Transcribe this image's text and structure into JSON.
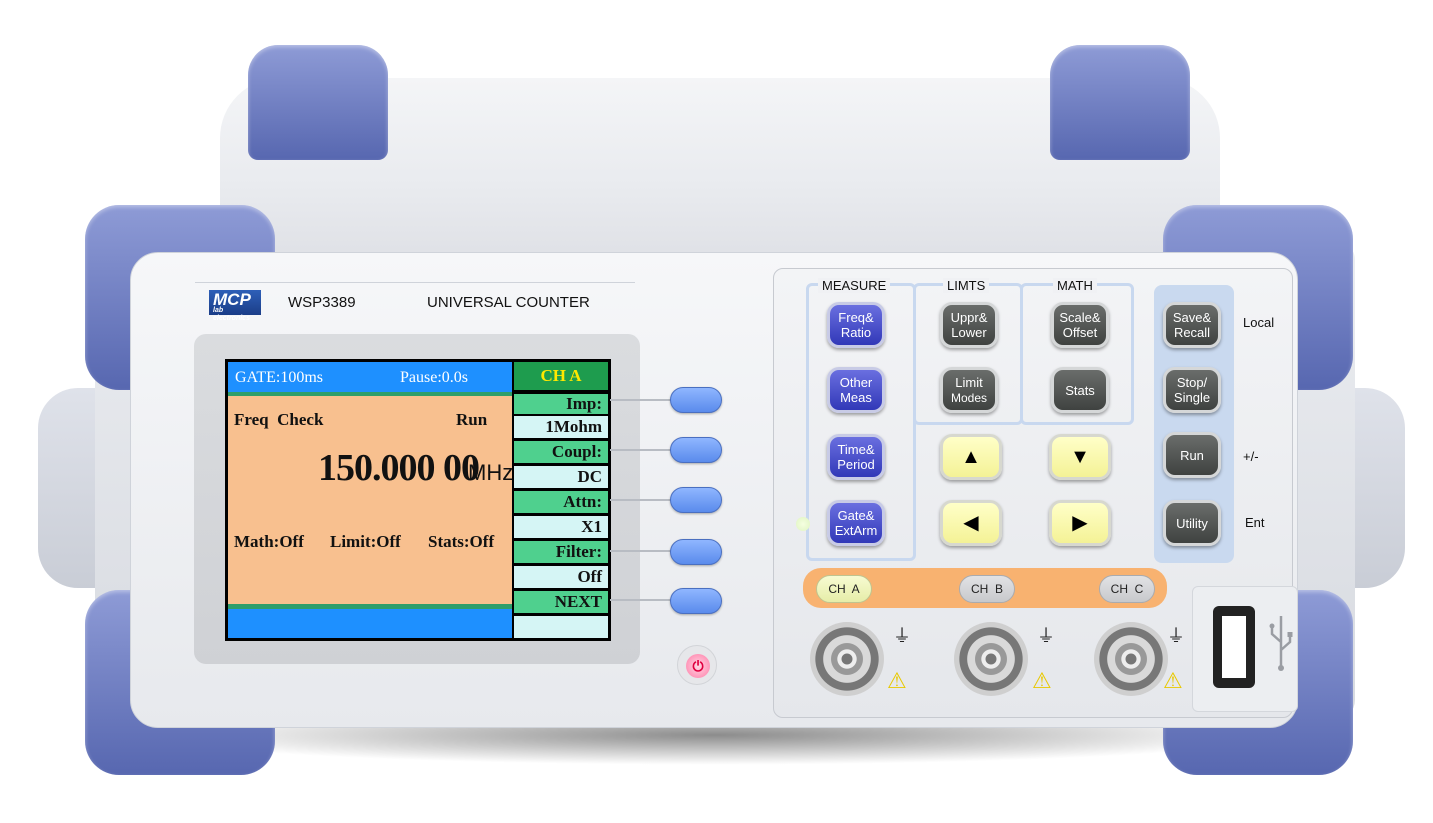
{
  "brand": {
    "logo": "MCP",
    "logo_sub": "lab electronics",
    "model": "WSP3389",
    "product": "UNIVERSAL COUNTER"
  },
  "display": {
    "gate": "GATE:100ms",
    "pause": "Pause:0.0s",
    "mode": "Freq  Check",
    "run_state": "Run",
    "reading": "150.000 00",
    "unit": "MHz",
    "math": "Math:Off",
    "limit": "Limit:Off",
    "stats": "Stats:Off",
    "channel_title": "CH A",
    "softkeys": [
      {
        "label": "Imp:",
        "value": "1Mohm"
      },
      {
        "label": "Coupl:",
        "value": "DC"
      },
      {
        "label": "Attn:",
        "value": "X1"
      },
      {
        "label": "Filter:",
        "value": "Off"
      },
      {
        "label": "NEXT",
        "value": ""
      }
    ]
  },
  "groups": {
    "measure": "MEASURE",
    "limits": "LIMTS",
    "math": "MATH"
  },
  "keys": {
    "freq_ratio": [
      "Freq&",
      "Ratio"
    ],
    "other_meas": [
      "Other",
      "Meas"
    ],
    "time_period": [
      "Time&",
      "Period"
    ],
    "gate_extarm": [
      "Gate&",
      "ExtArm"
    ],
    "uppr_lower": [
      "Uppr&",
      "Lower"
    ],
    "limit_modes": [
      "Limit",
      "Modes"
    ],
    "scale_offset": [
      "Scale&",
      "Offset"
    ],
    "stats": "Stats",
    "save_recall": [
      "Save&",
      "Recall"
    ],
    "stop_single": [
      "Stop/",
      "Single"
    ],
    "run": "Run",
    "utility": "Utility"
  },
  "side_labels": {
    "local": "Local",
    "plus_minus": "+/-",
    "ent": "Ent"
  },
  "channels": [
    "CH  A",
    "CH  B",
    "CH  C"
  ],
  "icons": {
    "up": "▲",
    "down": "▼",
    "left": "◀",
    "right": "▶",
    "ground": "⏚",
    "warning": "⚠",
    "power": "⏻",
    "usb": "usb-icon"
  }
}
